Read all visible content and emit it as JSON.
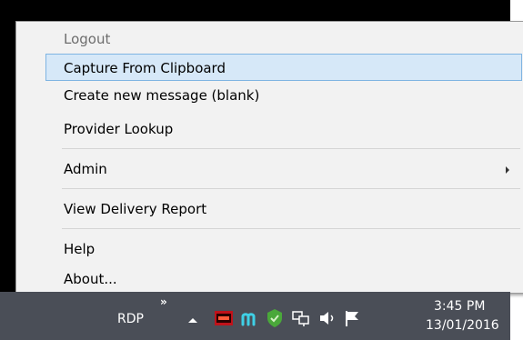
{
  "menu": {
    "items": [
      {
        "label": "Logout",
        "state": "disabled"
      },
      {
        "label": "Capture From Clipboard",
        "state": "highlighted"
      },
      {
        "label": "Create new message (blank)",
        "state": "normal"
      },
      {
        "label": "Provider Lookup",
        "state": "normal"
      },
      {
        "label": "Admin",
        "state": "normal",
        "submenu": true
      },
      {
        "label": "View Delivery Report",
        "state": "normal"
      },
      {
        "label": "Help",
        "state": "normal"
      },
      {
        "label": "About...",
        "state": "normal"
      }
    ]
  },
  "taskbar": {
    "toolbar_label": "RDP",
    "overflow_chevron": "»",
    "tray_icons": [
      "show-hidden-icons-arrow-icon",
      "red-app-icon",
      "m-app-icon",
      "green-shield-icon",
      "network-icon",
      "volume-icon",
      "action-center-flag-icon"
    ],
    "clock_time": "3:45 PM",
    "clock_date": "13/01/2016"
  },
  "colors": {
    "menu_background": "#f2f2f2",
    "highlight_fill": "#d6e8f8",
    "highlight_border": "#7fb4e2",
    "taskbar": "#4a4e57",
    "desktop": "#000000"
  }
}
